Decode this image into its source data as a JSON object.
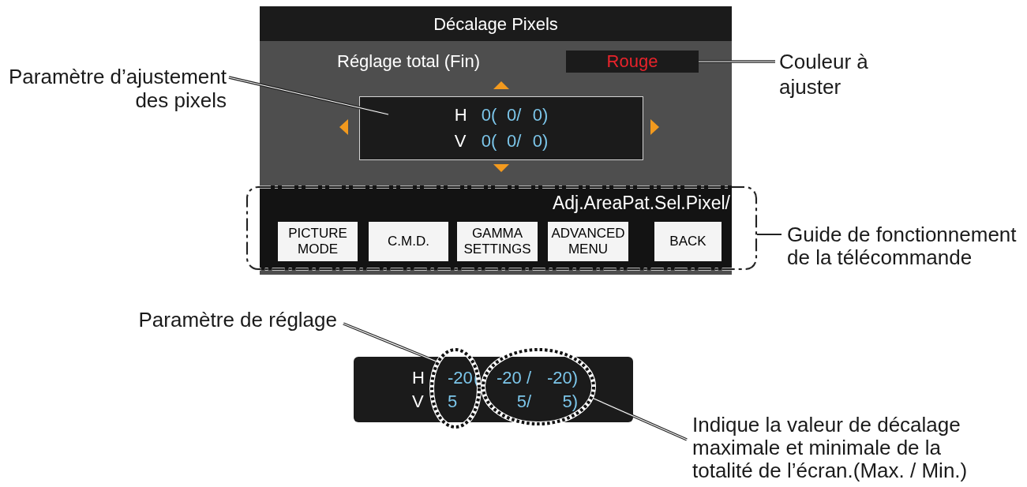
{
  "menu": {
    "title": "Décalage Pixels",
    "mode_label": "Réglage total (Fin)",
    "color_value": "Rouge",
    "adjust_box": {
      "rows": [
        {
          "axis": "H",
          "value": "0",
          "paren": "(",
          "max": "0/",
          "min": "0)"
        },
        {
          "axis": "V",
          "value": "0",
          "paren": "(",
          "max": "0/",
          "min": "0)"
        }
      ]
    },
    "guide": {
      "texts": [
        "Adj.AreaPat.",
        "Sel.Pix",
        "el/"
      ],
      "buttons": [
        "PICTURE\nMODE",
        "C.M.D.",
        "GAMMA\nSETTINGS",
        "ADVANCED\nMENU",
        "BACK"
      ]
    }
  },
  "setting_display": {
    "rows": [
      {
        "axis": "H",
        "value": "-20",
        "paren": "(",
        "max": "-20 /",
        "min": "-20)"
      },
      {
        "axis": "V",
        "value": "5",
        "max": "5/",
        "min": "5)"
      }
    ]
  },
  "callouts": [
    "Paramètre d’ajustement\ndes pixels",
    "Couleur à\najuster",
    "Guide de fonctionnement\nde la télécommande",
    "Paramètre de réglage",
    "Indique la valeur de décalage\nmaximale et minimale de la\ntotalité de l’écran.(Max. / Min.)"
  ]
}
